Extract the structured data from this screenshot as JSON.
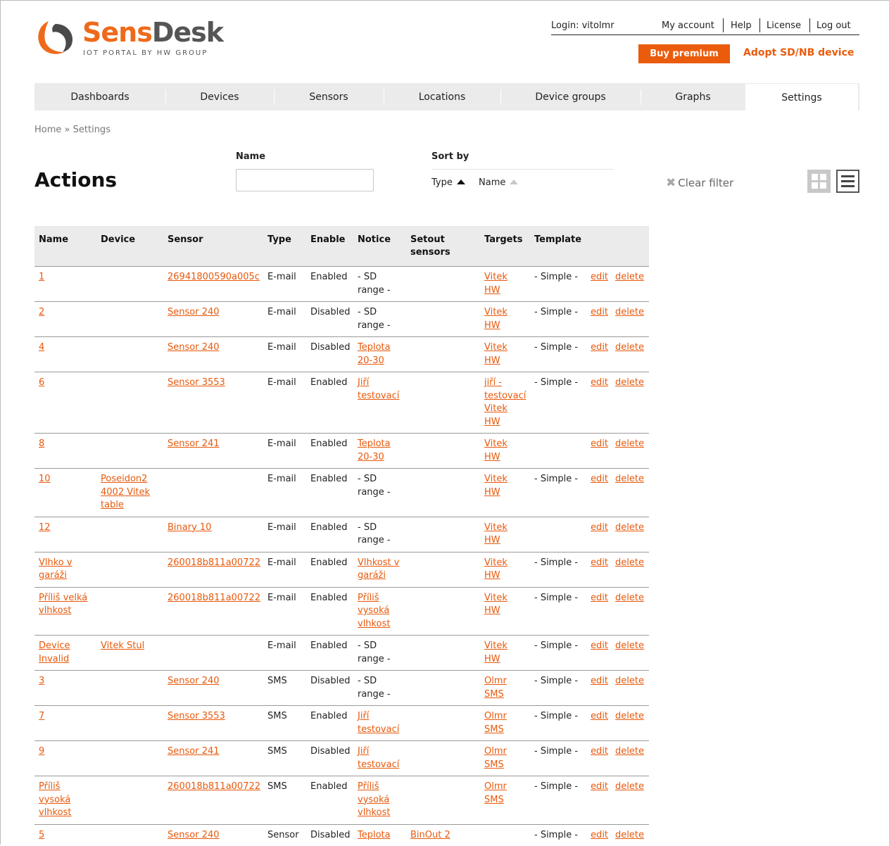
{
  "brand": {
    "name_part1": "Sens",
    "name_part2": "Desk",
    "tagline": "IOT PORTAL BY HW GROUP"
  },
  "header": {
    "login_label": "Login:",
    "login_user": "vitolmr",
    "links": [
      "My account",
      "Help",
      "License",
      "Log out"
    ],
    "buy_premium": "Buy premium",
    "adopt": "Adopt SD/NB device"
  },
  "nav": {
    "tabs": [
      "Dashboards",
      "Devices",
      "Sensors",
      "Locations",
      "Device groups",
      "Graphs",
      "Settings"
    ],
    "active": "Settings"
  },
  "breadcrumb": {
    "home": "Home",
    "separator": "»",
    "current": "Settings"
  },
  "filter": {
    "title": "Actions",
    "name_label": "Name",
    "name_value": "",
    "sort_label": "Sort by",
    "sort_type": "Type",
    "sort_name": "Name",
    "clear": "Clear filter"
  },
  "table": {
    "headers": [
      "Name",
      "Device",
      "Sensor",
      "Type",
      "Enable",
      "Notice",
      "Setout sensors",
      "Targets",
      "Template",
      ""
    ],
    "edit_label": "edit",
    "delete_label": "delete",
    "rows": [
      {
        "name": "1",
        "device": "",
        "sensor": "26941800590a005c",
        "type": "E-mail",
        "enable": "Enabled",
        "notice": "- SD range -",
        "notice_link": false,
        "setout": "",
        "targets": "Vitek HW",
        "template": "- Simple -"
      },
      {
        "name": "2",
        "device": "",
        "sensor": "Sensor 240",
        "type": "E-mail",
        "enable": "Disabled",
        "notice": "- SD range -",
        "notice_link": false,
        "setout": "",
        "targets": "Vitek HW",
        "template": "- Simple -"
      },
      {
        "name": "4",
        "device": "",
        "sensor": "Sensor 240",
        "type": "E-mail",
        "enable": "Disabled",
        "notice": "Teplota 20-30",
        "notice_link": true,
        "setout": "",
        "targets": "Vitek HW",
        "template": "- Simple -"
      },
      {
        "name": "6",
        "device": "",
        "sensor": "Sensor 3553",
        "type": "E-mail",
        "enable": "Enabled",
        "notice": "Jiří testovací",
        "notice_link": true,
        "setout": "",
        "targets": "jiří - testovací Vitek HW",
        "template": "- Simple -"
      },
      {
        "name": "8",
        "device": "",
        "sensor": "Sensor 241",
        "type": "E-mail",
        "enable": "Enabled",
        "notice": "Teplota 20-30",
        "notice_link": true,
        "setout": "",
        "targets": "Vitek HW",
        "template": ""
      },
      {
        "name": "10",
        "device": "Poseidon2 4002 Vitek table",
        "sensor": "",
        "type": "E-mail",
        "enable": "Enabled",
        "notice": "- SD range -",
        "notice_link": false,
        "setout": "",
        "targets": "Vitek HW",
        "template": "- Simple -"
      },
      {
        "name": "12",
        "device": "",
        "sensor": "Binary 10",
        "type": "E-mail",
        "enable": "Enabled",
        "notice": "- SD range -",
        "notice_link": false,
        "setout": "",
        "targets": "Vitek HW",
        "template": ""
      },
      {
        "name": "Vlhko v garáži",
        "device": "",
        "sensor": "260018b811a00722",
        "type": "E-mail",
        "enable": "Enabled",
        "notice": "Vlhkost v garáži",
        "notice_link": true,
        "setout": "",
        "targets": "Vitek HW",
        "template": "- Simple -"
      },
      {
        "name": "Příliš velká vlhkost",
        "device": "",
        "sensor": "260018b811a00722",
        "type": "E-mail",
        "enable": "Enabled",
        "notice": "Příliš vysoká vlhkost",
        "notice_link": true,
        "setout": "",
        "targets": "Vitek HW",
        "template": "- Simple -"
      },
      {
        "name": "Device Invalid",
        "device": "Vitek Stul",
        "sensor": "",
        "type": "E-mail",
        "enable": "Enabled",
        "notice": "- SD range -",
        "notice_link": false,
        "setout": "",
        "targets": "Vitek HW",
        "template": "- Simple -"
      },
      {
        "name": "3",
        "device": "",
        "sensor": "Sensor 240",
        "type": "SMS",
        "enable": "Disabled",
        "notice": "- SD range -",
        "notice_link": false,
        "setout": "",
        "targets": "Olmr SMS",
        "template": "- Simple -"
      },
      {
        "name": "7",
        "device": "",
        "sensor": "Sensor 3553",
        "type": "SMS",
        "enable": "Enabled",
        "notice": "Jiří testovací",
        "notice_link": true,
        "setout": "",
        "targets": "Olmr SMS",
        "template": "- Simple -"
      },
      {
        "name": "9",
        "device": "",
        "sensor": "Sensor 241",
        "type": "SMS",
        "enable": "Disabled",
        "notice": "Jiří testovací",
        "notice_link": true,
        "setout": "",
        "targets": "Olmr SMS",
        "template": "- Simple -"
      },
      {
        "name": "Příliš vysoká vlhkost",
        "device": "",
        "sensor": "260018b811a00722",
        "type": "SMS",
        "enable": "Enabled",
        "notice": "Příliš vysoká vlhkost",
        "notice_link": true,
        "setout": "",
        "targets": "Olmr SMS",
        "template": "- Simple -"
      },
      {
        "name": "5",
        "device": "",
        "sensor": "Sensor 240",
        "type": "Sensor",
        "enable": "Disabled",
        "notice": "Teplota",
        "notice_link": true,
        "setout": "BinOut 2",
        "targets": "",
        "template": "- Simple -"
      }
    ]
  },
  "colors": {
    "accent": "#ea5b0c",
    "nav_bg": "#ebebeb",
    "header_bg": "#ebebeb"
  },
  "icons": [
    "logo-mark-icon",
    "sort-asc-icon",
    "clear-x-icon",
    "grid-view-icon",
    "list-view-icon"
  ]
}
